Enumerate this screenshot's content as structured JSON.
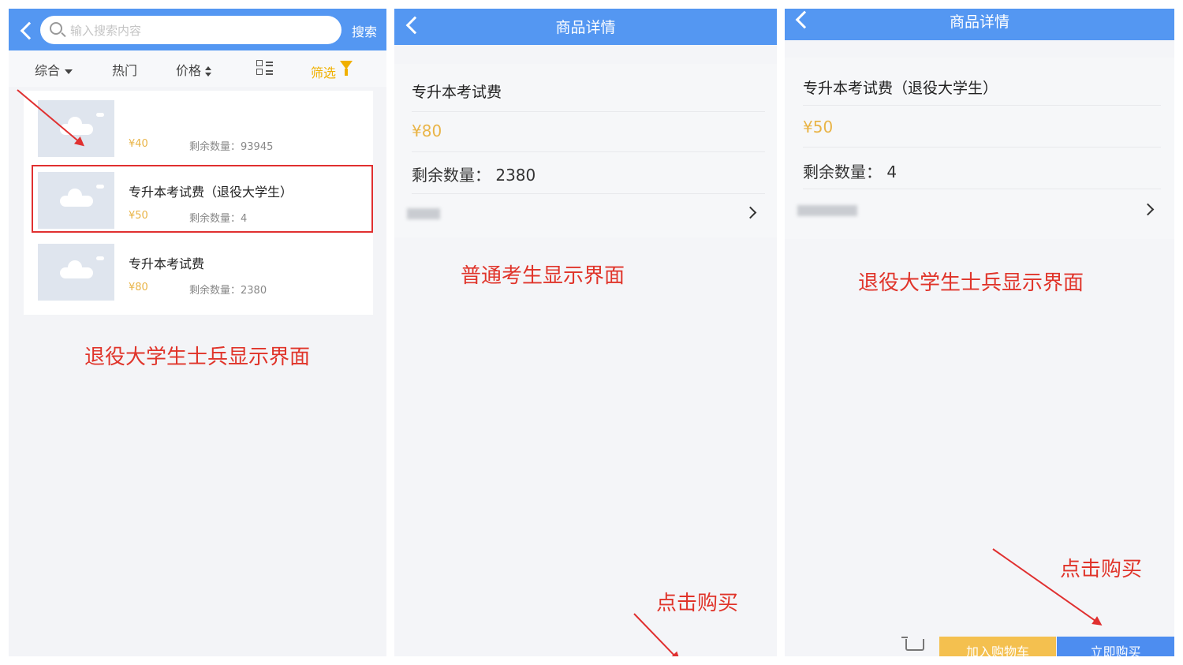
{
  "list_screen": {
    "search": {
      "placeholder": "输入搜索内容",
      "button_label": "搜索"
    },
    "filter_tabs": {
      "comprehensive": "综合",
      "hot": "热门",
      "price": "价格",
      "filter": "筛选"
    },
    "items": [
      {
        "name": "",
        "price": "¥40",
        "stock": "剩余数量：93945"
      },
      {
        "name": "专升本考试费（退役大学生）",
        "price": "¥50",
        "stock": "剩余数量：4"
      },
      {
        "name": "专升本考试费",
        "price": "¥80",
        "stock": "剩余数量：2380"
      }
    ],
    "annotation": "退役大学生士兵显示界面"
  },
  "detail_regular": {
    "title": "商品详情",
    "product_name": "专升本考试费",
    "price": "¥80",
    "stock": "剩余数量：   2380",
    "annotation": "普通考生显示界面",
    "click_hint": "点击购买"
  },
  "detail_veteran": {
    "title": "商品详情",
    "product_name": "专升本考试费（退役大学生）",
    "price": "¥50",
    "stock": "剩余数量：   4",
    "annotation": "退役大学生士兵显示界面",
    "click_hint": "点击购买",
    "add_to_cart": "加入购物车",
    "buy_now": "立即购买"
  },
  "colors": {
    "header_blue": "#5497f2",
    "price_yellow": "#e9b447",
    "annotation_red": "#e0342a",
    "cart_button": "#f4c04f",
    "buy_button": "#4d8df0"
  }
}
